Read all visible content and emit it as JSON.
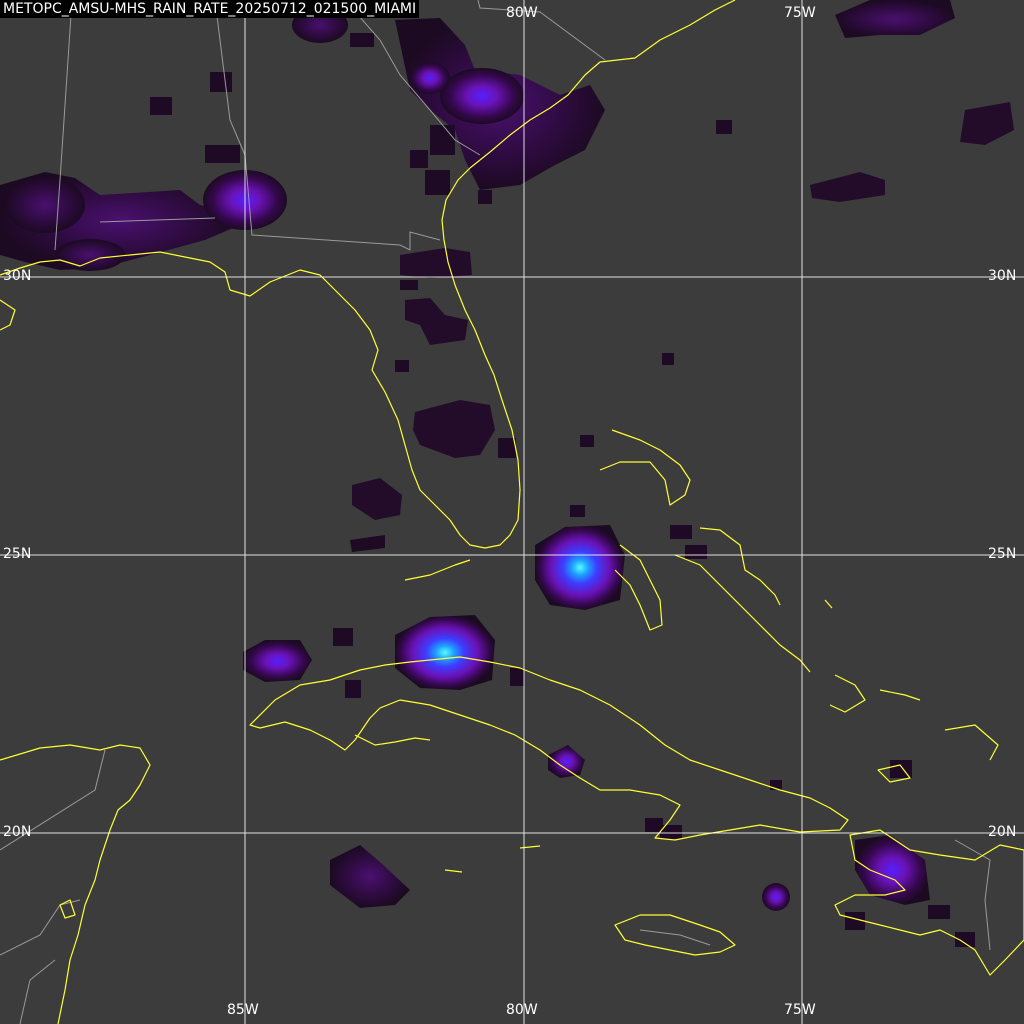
{
  "title": "METOPC_AMSU-MHS_RAIN_RATE_20250712_021500_MIAMI",
  "graticule": {
    "longitudes": [
      "85W",
      "80W",
      "75W"
    ],
    "latitudes": [
      "30N",
      "25N",
      "20N"
    ],
    "grid_color": "#ffffff"
  },
  "colors": {
    "background": "#3c3c3c",
    "coastline": "#ffff33",
    "borders": "#9a9a9a",
    "rain_low": "#2a0838",
    "rain_mid": "#6a12b8",
    "rain_high": "#3d3dff",
    "rain_peak": "#33ddff"
  }
}
